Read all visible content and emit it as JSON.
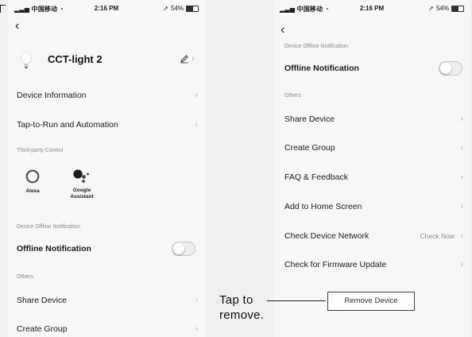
{
  "status_bar": {
    "carrier": "中国移动",
    "time": "2:16 PM",
    "battery": "54%",
    "battery_level": 0.54
  },
  "left_screen": {
    "device_name": "CCT-light 2",
    "rows": {
      "device_information": "Device Information",
      "tap_to_run": "Tap-to-Run and Automation"
    },
    "third_party_label": "Third-party Control",
    "assistants": [
      {
        "name": "Alexa",
        "icon": "alexa-icon"
      },
      {
        "name": "Google Assistant",
        "icon": "google-assistant-icon"
      }
    ],
    "offline_section_label": "Device Offline Notification",
    "offline_notification": "Offline Notification",
    "offline_enabled": false,
    "others_label": "Others",
    "share_device": "Share Device",
    "create_group": "Create Group"
  },
  "right_screen": {
    "offline_section_label": "Device Offline Notification",
    "offline_notification": "Offline Notification",
    "offline_enabled": false,
    "others_label": "Others",
    "rows": {
      "share_device": "Share Device",
      "create_group": "Create Group",
      "faq_feedback": "FAQ & Feedback",
      "add_to_home": "Add to Home Screen",
      "check_network": "Check Device Network",
      "check_network_value": "Check Now",
      "check_firmware": "Check for Firmware Update"
    },
    "remove_device": "Remove Device"
  },
  "annotation": {
    "line1": "Tap to",
    "line2": "remove."
  },
  "icons": {
    "back": "back-arrow-icon",
    "chevron": "chevron-right-icon",
    "edit": "pencil-icon",
    "bulb": "bulb-icon",
    "wifi": "wifi-icon",
    "signal": "signal-icon",
    "battery": "battery-icon"
  }
}
